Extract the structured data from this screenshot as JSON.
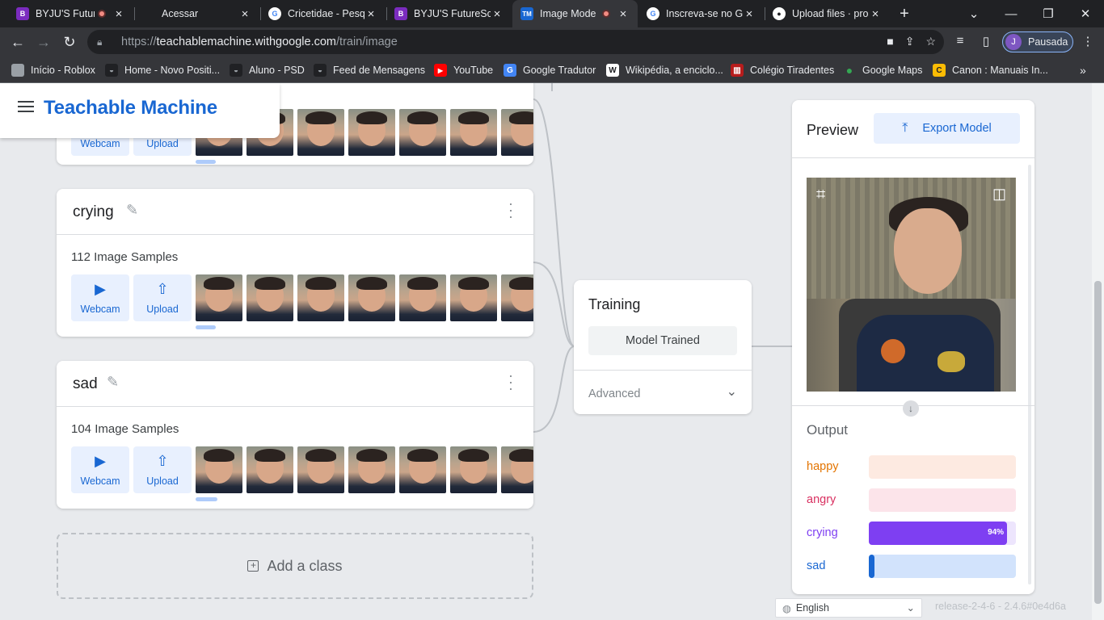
{
  "browser": {
    "tabs": [
      {
        "title": "BYJU'S Futur",
        "favicon": "byjus",
        "recording": true
      },
      {
        "title": "Acessar",
        "favicon": "none",
        "recording": false
      },
      {
        "title": "Cricetidae - Pesq",
        "favicon": "google",
        "recording": false
      },
      {
        "title": "BYJU'S FutureSch",
        "favicon": "byjus",
        "recording": false
      },
      {
        "title": "Image Mode",
        "favicon": "tm",
        "recording": true,
        "active": true
      },
      {
        "title": "Inscreva-se no G",
        "favicon": "google",
        "recording": false
      },
      {
        "title": "Upload files · pro",
        "favicon": "github",
        "recording": false
      }
    ],
    "url_prefix": "https://",
    "url_host": "teachablemachine.withgoogle.com",
    "url_path": "/train/image",
    "profile_initial": "J",
    "profile_label": "Pausada",
    "bookmarks": [
      "Início - Roblox",
      "Home - Novo Positi...",
      "Aluno - PSD",
      "Feed de Mensagens",
      "YouTube",
      "Google Tradutor",
      "Wikipédia, a enciclo...",
      "Colégio Tiradentes",
      "Google Maps",
      "Canon : Manuais In..."
    ]
  },
  "app": {
    "brand": "Teachable Machine",
    "top_class": {
      "webcam_label": "Webcam",
      "upload_label": "Upload"
    },
    "classes": [
      {
        "name": "crying",
        "samples": "112 Image Samples",
        "webcam_label": "Webcam",
        "upload_label": "Upload"
      },
      {
        "name": "sad",
        "samples": "104 Image Samples",
        "webcam_label": "Webcam",
        "upload_label": "Upload"
      }
    ],
    "add_class": "Add a class",
    "training": {
      "title": "Training",
      "status_button": "Model Trained",
      "advanced": "Advanced"
    },
    "preview": {
      "title": "Preview",
      "export_button": "Export Model",
      "output_title": "Output",
      "outputs": [
        {
          "label": "happy",
          "value": 0,
          "pct_label": "",
          "label_color": "#e37400",
          "track": "#fdeae1",
          "fill": "#e37400"
        },
        {
          "label": "angry",
          "value": 0,
          "pct_label": "",
          "label_color": "#d93060",
          "track": "#fce4ea",
          "fill": "#d93060"
        },
        {
          "label": "crying",
          "value": 0.94,
          "pct_label": "94%",
          "label_color": "#7e3ff2",
          "track": "#ede5fd",
          "fill": "#7e3ff2"
        },
        {
          "label": "sad",
          "value": 0.04,
          "pct_label": "",
          "label_color": "#1967d2",
          "track": "#d2e3fc",
          "fill": "#1967d2"
        }
      ]
    },
    "footer": {
      "language": "English",
      "release": "release-2-4-6 - 2.4.6#0e4d6a"
    }
  }
}
